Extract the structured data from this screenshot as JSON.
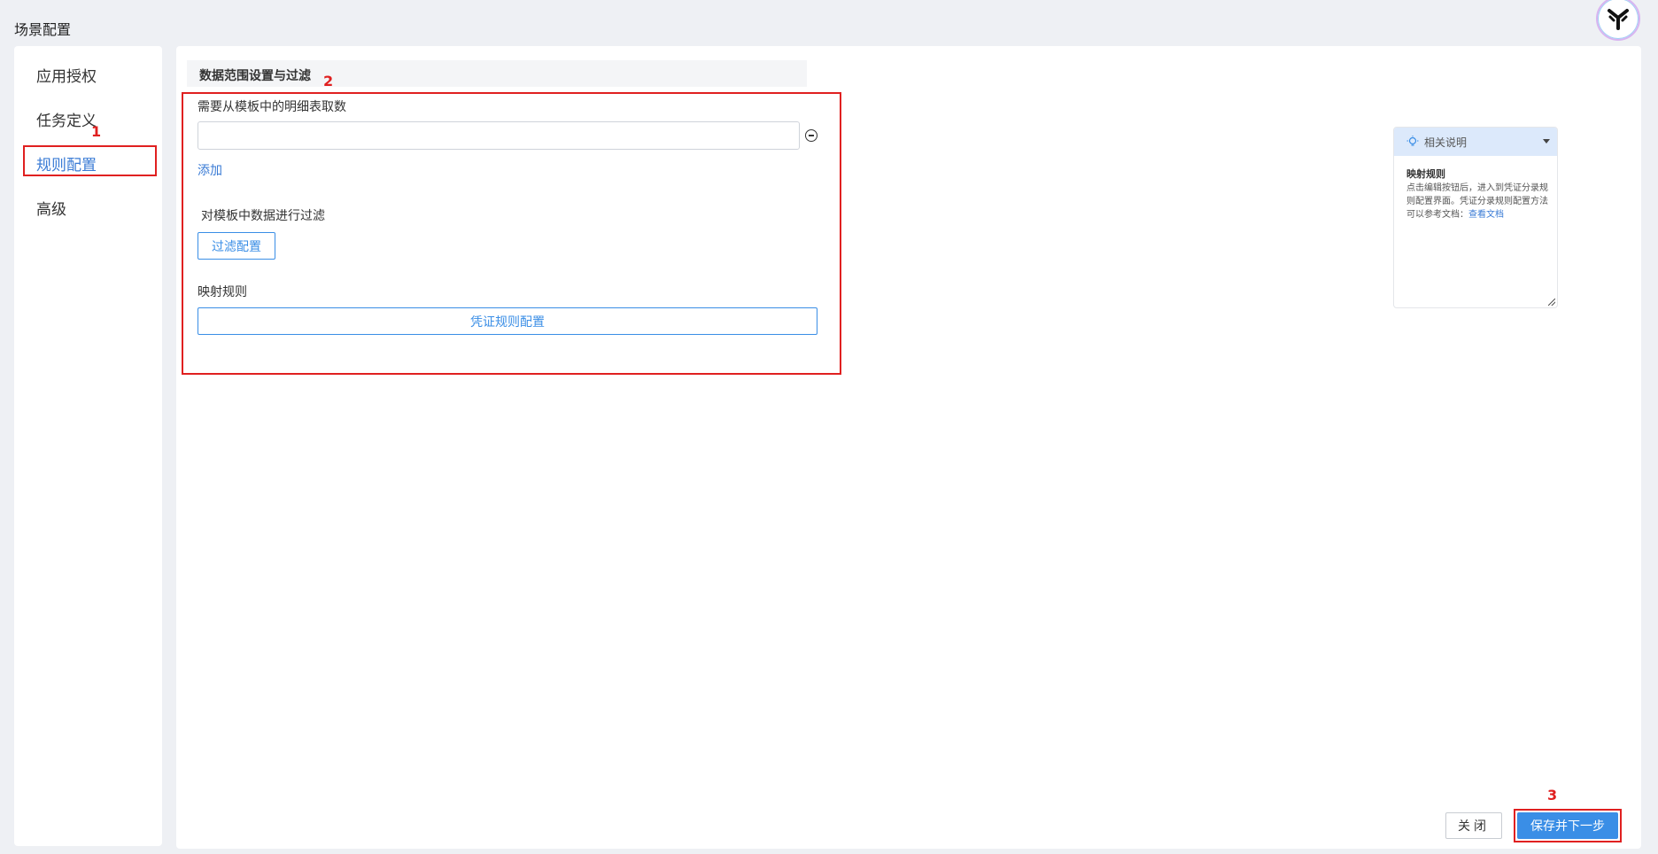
{
  "header": {
    "title": "场景配置"
  },
  "sidebar": {
    "items": [
      {
        "label": "应用授权"
      },
      {
        "label": "任务定义"
      },
      {
        "label": "规则配置"
      },
      {
        "label": "高级"
      }
    ]
  },
  "annotations": {
    "n1": "1",
    "n2": "2",
    "n3": "3"
  },
  "section": {
    "title": "数据范围设置与过滤",
    "detail_table_label": "需要从模板中的明细表取数",
    "detail_table_value": "",
    "add_link": "添加",
    "filter_label": "对模板中数据进行过滤",
    "filter_button": "过滤配置",
    "mapping_label": "映射规则",
    "voucher_rule_button": "凭证规则配置"
  },
  "help": {
    "header": "相关说明",
    "title": "映射规则",
    "body": "点击编辑按钮后，进入到凭证分录规则配置界面。凭证分录规则配置方法可以参考文档：",
    "link": "查看文档"
  },
  "footer": {
    "close_label": "关闭",
    "save_label": "保存并下一步"
  },
  "colors": {
    "accent": "#3a8ee6",
    "annotation": "#e02020"
  }
}
